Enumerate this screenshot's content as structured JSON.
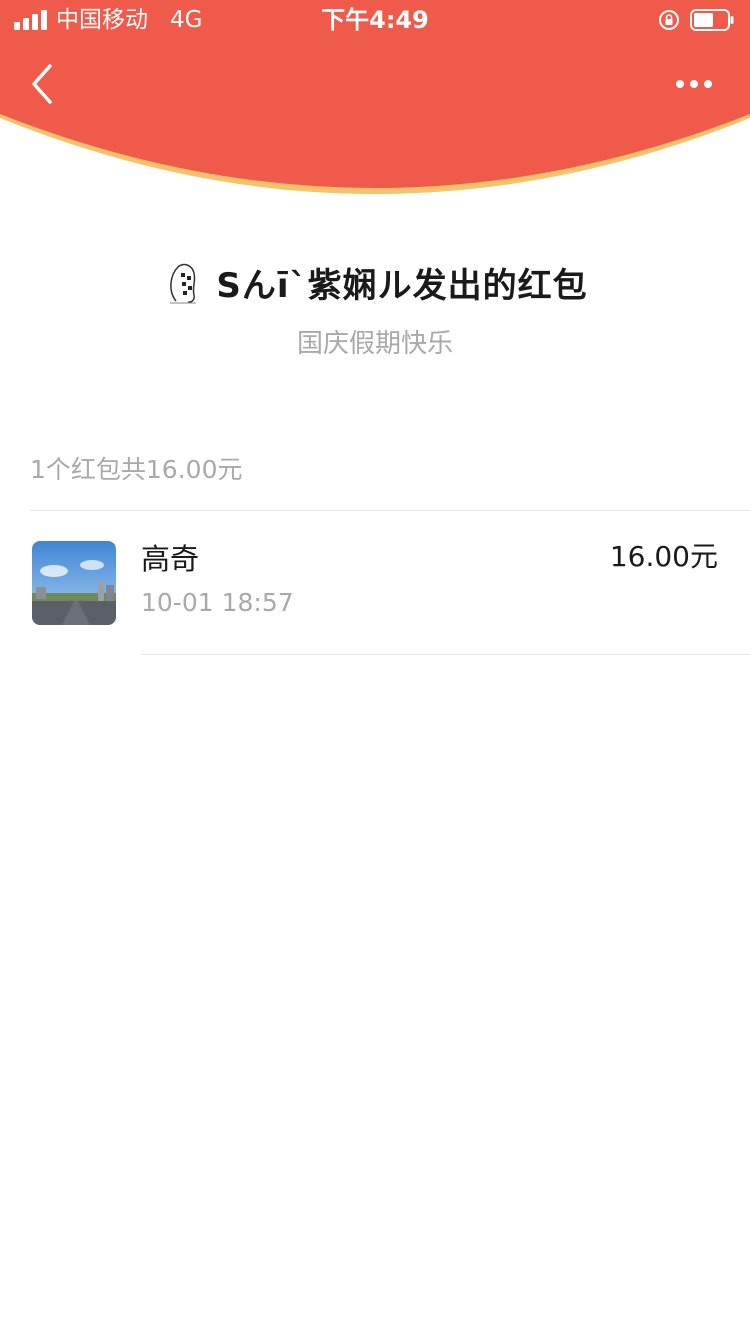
{
  "status_bar": {
    "carrier": "中国移动",
    "network": "4G",
    "time": "下午4:49"
  },
  "nav": {
    "back_icon": "chevron-left-icon",
    "more_icon": "more-dots-icon"
  },
  "colors": {
    "header_red": "#EF5A4A",
    "header_rim": "#F5C36B",
    "primary_text": "#1A1A1A",
    "secondary_text": "#A9A9A9",
    "divider": "#E6E6E6"
  },
  "packet": {
    "sender_title": "Sんī`紫娴ル发出的红包",
    "greeting": "国庆假期快乐"
  },
  "summary": {
    "text": "1个红包共16.00元"
  },
  "records": [
    {
      "name": "高奇",
      "time": "10-01 18:57",
      "amount": "16.00元"
    }
  ]
}
